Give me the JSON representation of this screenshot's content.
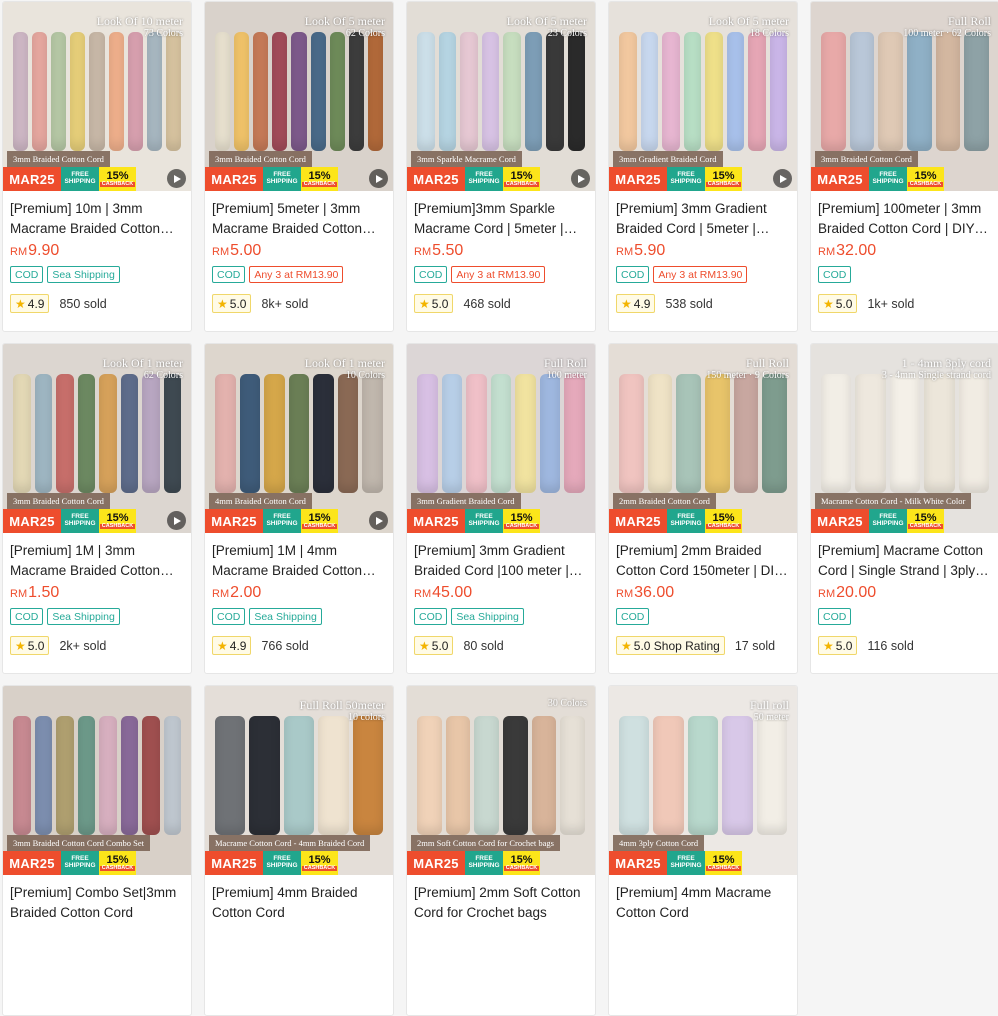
{
  "promo": {
    "mar_label": "MAR25",
    "free_line1": "FREE",
    "free_line2": "SHIPPING",
    "cash_pct": "15%",
    "cash_label": "CASHBACK"
  },
  "currency": "RM",
  "products": [
    {
      "title": "[Premium] 10m | 3mm Macrame Braided Cotton Cord",
      "price": "9.90",
      "tags": [
        "COD",
        "Sea Shipping"
      ],
      "rating": "5.0",
      "rating_display": "4.9",
      "sold": "850 sold",
      "overlay_line1": "Look Of 10 meter",
      "overlay_line2": "73 Colors",
      "caption": "3mm Braided Cotton Cord",
      "video": true,
      "bg": "#e9e4dc",
      "stripes": [
        "#cfb8c6",
        "#e7a8a0",
        "#b7c9a6",
        "#e8d07a",
        "#c9b9a8",
        "#f0b08c",
        "#d9a1b0",
        "#a8b8c2",
        "#d8c4a0"
      ]
    },
    {
      "title": "[Premium] 5meter | 3mm Macrame Braided Cotton Cord",
      "price": "5.00",
      "tags": [
        "COD",
        "Any 3 at RM13.90"
      ],
      "rating_display": "5.0",
      "sold": "8k+ sold",
      "overlay_line1": "Look Of 5 meter",
      "overlay_line2": "62 Colors",
      "caption": "3mm Braided Cotton Cord",
      "video": true,
      "bg": "#d9d2cb",
      "stripes": [
        "#e9e2d0",
        "#f2c46a",
        "#c77b58",
        "#a34c5a",
        "#7e5a8c",
        "#4a6b8a",
        "#6f8c5a",
        "#3d3d3d",
        "#b36a3a"
      ]
    },
    {
      "title": "[Premium]3mm Sparkle Macrame Cord | 5meter | DIY",
      "price": "5.50",
      "tags": [
        "COD",
        "Any 3 at RM13.90"
      ],
      "rating_display": "5.0",
      "sold": "468 sold",
      "overlay_line1": "Look Of 5 meter",
      "overlay_line2": "23 Colors",
      "caption": "3mm Sparkle Macrame Cord",
      "video": true,
      "bg": "#e2ddd6",
      "stripes": [
        "#cde0ea",
        "#b7d6e4",
        "#e7c9d4",
        "#d9c4e6",
        "#c8dfc0",
        "#7e9fb8",
        "#3a3a3a",
        "#2b2b2b"
      ]
    },
    {
      "title": "[Premium] 3mm Gradient Braided Cord | 5meter | Macrame",
      "price": "5.90",
      "tags": [
        "COD",
        "Any 3 at RM13.90"
      ],
      "rating_display": "4.9",
      "sold": "538 sold",
      "overlay_line1": "Look Of 5 meter",
      "overlay_line2": "18 Colors",
      "caption": "3mm Gradient Braided Cord",
      "video": true,
      "bg": "#e6e1db",
      "stripes": [
        "#f3c9a0",
        "#c9d9f0",
        "#e8b7d2",
        "#b9e0c6",
        "#f0e18a",
        "#a9c2ec",
        "#e7a7b6",
        "#cbb7e9"
      ]
    },
    {
      "title": "[Premium] 100meter | 3mm Braided Cotton Cord | DIY Macrame",
      "price": "32.00",
      "tags": [
        "COD"
      ],
      "rating_display": "5.0",
      "sold": "1k+ sold",
      "overlay_line1": "Full Roll",
      "overlay_line2": "100 meter · 62 Colors",
      "caption": "3mm Braided Cotton Cord",
      "video": false,
      "bg": "#ddd5cf",
      "stripes": [
        "#e8a9a8",
        "#b9c7d8",
        "#dfc9b5",
        "#8fb0c6",
        "#d3b7a0",
        "#8ea2a6"
      ]
    },
    {
      "title": "[Premium] 1M | 3mm Macrame Braided Cotton Cord",
      "price": "1.50",
      "tags": [
        "COD",
        "Sea Shipping"
      ],
      "rating_display": "5.0",
      "sold": "2k+ sold",
      "overlay_line1": "Look Of 1 meter",
      "overlay_line2": "62 Colors",
      "caption": "3mm Braided Cotton Cord",
      "video": true,
      "bg": "#dcd6d0",
      "stripes": [
        "#e4d9b6",
        "#9fb7c3",
        "#c86f6b",
        "#6d8a62",
        "#d7a25b",
        "#5f6d8c",
        "#b9a7c2",
        "#3f4a52"
      ]
    },
    {
      "title": "[Premium] 1M | 4mm Macrame Braided Cotton Cord",
      "price": "2.00",
      "tags": [
        "COD",
        "Sea Shipping"
      ],
      "rating_display": "4.9",
      "sold": "766 sold",
      "overlay_line1": "Look Of 1 meter",
      "overlay_line2": "10 Colors",
      "caption": "4mm Braided Cotton Cord",
      "video": true,
      "bg": "#ddd6cd",
      "stripes": [
        "#e3b2ae",
        "#3f5c7a",
        "#d5a74a",
        "#6b7f56",
        "#2b2f3a",
        "#8b6a55",
        "#c0b7ad"
      ]
    },
    {
      "title": "[Premium] 3mm Gradient Braided Cord |100 meter | Macrame",
      "price": "45.00",
      "tags": [
        "COD",
        "Sea Shipping"
      ],
      "rating_display": "5.0",
      "sold": "80 sold",
      "overlay_line1": "Full Roll",
      "overlay_line2": "100 meter",
      "caption": "3mm Gradient Braided Cord",
      "video": false,
      "bg": "#dcd6d6",
      "stripes": [
        "#d8c0e4",
        "#b8cfe8",
        "#f0c0c8",
        "#c4e0d0",
        "#f1e3a0",
        "#9fb8e0",
        "#e5a9bb"
      ]
    },
    {
      "title": "[Premium] 2mm Braided Cotton Cord 150meter | DIY Macrame",
      "price": "36.00",
      "tags": [
        "COD"
      ],
      "rating_display": "5.0 Shop Rating",
      "sold": "17 sold",
      "overlay_line1": "Full Roll",
      "overlay_line2": "150 meter · 9 Colors",
      "caption": "2mm Braided Cotton Cord",
      "video": false,
      "bg": "#e4ddd6",
      "stripes": [
        "#f0c4c0",
        "#efe3c6",
        "#a8c4b8",
        "#e8c46a",
        "#c8a7a0",
        "#7e9c8e"
      ]
    },
    {
      "title": "[Premium] Macrame Cotton Cord | Single Strand | 3ply Cotton",
      "price": "20.00",
      "tags": [
        "COD"
      ],
      "rating_display": "5.0",
      "sold": "116 sold",
      "overlay_line1": "1 - 4mm 3ply cord",
      "overlay_line2": "3 - 4mm Single strand cord",
      "caption": "Macrame Cotton Cord - Milk White Color",
      "video": false,
      "bg": "#e5e2de",
      "stripes": [
        "#f2eee6",
        "#eee8de",
        "#f4f0e8",
        "#ece6da",
        "#f1ece3"
      ]
    },
    {
      "title": "[Premium] Combo Set|3mm Braided Cotton Cord",
      "price": "",
      "tags": [],
      "rating_display": "",
      "sold": "",
      "overlay_line1": "",
      "overlay_line2": "",
      "caption": "3mm Braided Cotton Cord Combo Set",
      "video": false,
      "bg": "#d8d0c8",
      "stripes": [
        "#c88a92",
        "#7d8fb0",
        "#b0a070",
        "#6d9a8a",
        "#d8b0c0",
        "#8a6a9a",
        "#a05050",
        "#c0c8d0"
      ]
    },
    {
      "title": "[Premium] 4mm Braided Cotton Cord",
      "price": "",
      "tags": [],
      "rating_display": "",
      "sold": "",
      "overlay_line1": "Full Roll 50meter",
      "overlay_line2": "10 colors",
      "caption": "Macrame Cotton Cord - 4mm Braided Cord",
      "video": false,
      "bg": "#e4ded8",
      "stripes": [
        "#6f7276",
        "#2c2f36",
        "#a9c9c8",
        "#efe3d0",
        "#c9853f"
      ]
    },
    {
      "title": "[Premium] 2mm Soft Cotton Cord for Crochet bags",
      "price": "",
      "tags": [],
      "rating_display": "",
      "sold": "",
      "overlay_line1": "",
      "overlay_line2": "30 Colors",
      "caption": "2mm Soft Cotton Cord for Crochet bags",
      "video": false,
      "bg": "#e3ddd6",
      "stripes": [
        "#f0d2b8",
        "#e8c6a8",
        "#c8d8d0",
        "#3a3a3a",
        "#d8b49a",
        "#e6e0d6"
      ]
    },
    {
      "title": "[Premium] 4mm Macrame Cotton Cord",
      "price": "",
      "tags": [],
      "rating_display": "",
      "sold": "",
      "overlay_line1": "Full roll",
      "overlay_line2": "50 meter",
      "caption": "4mm 3ply Cotton Cord",
      "video": false,
      "bg": "#ece8e4",
      "stripes": [
        "#cfe0e0",
        "#f0c8b8",
        "#b8d8cc",
        "#d8c8e8",
        "#f2eee6"
      ]
    }
  ]
}
